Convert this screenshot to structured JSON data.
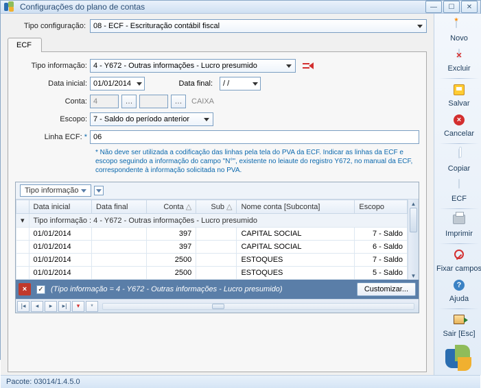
{
  "window": {
    "title": "Configurações do plano de contas"
  },
  "toolbar": {
    "novo": "Novo",
    "excluir": "Excluir",
    "salvar": "Salvar",
    "cancelar": "Cancelar",
    "copiar": "Copiar",
    "ecf": "ECF",
    "imprimir": "Imprimir",
    "fixar": "Fixar campos",
    "ajuda": "Ajuda",
    "sair": "Sair [Esc]"
  },
  "top": {
    "tipo_config_label": "Tipo configuração:",
    "tipo_config_value": "08 - ECF - Escrituração contábil fiscal"
  },
  "tab": {
    "label": "ECF"
  },
  "form": {
    "tipo_info_label": "Tipo informação:",
    "tipo_info_value": "4 - Y672 - Outras informações - Lucro presumido",
    "data_inicial_label": "Data inicial:",
    "data_inicial_value": "01/01/2014",
    "data_final_label": "Data final:",
    "data_final_value": "/ /",
    "conta_label": "Conta:",
    "conta_value": "4",
    "conta_nome": "CAIXA",
    "escopo_label": "Escopo:",
    "escopo_value": "7 - Saldo do período anterior",
    "linha_label": "Linha ECF:",
    "linha_req": "*",
    "linha_value": "06",
    "note": "* Não deve ser utilizada a codificação das linhas pela tela do PVA da ECF. Indicar as linhas da ECF e escopo seguindo a informação do campo \"N°\", existente no leiaute do registro Y672, no manual da ECF, correspondente à informação solicitada no PVA."
  },
  "grid": {
    "group_field": "Tipo informação",
    "columns": {
      "data_inicial": "Data inicial",
      "data_final": "Data final",
      "conta": "Conta",
      "sub": "Sub",
      "nome": "Nome conta [Subconta]",
      "escopo": "Escopo"
    },
    "group_row": "Tipo informação : 4 - Y672 - Outras informações - Lucro presumido",
    "rows": [
      {
        "data_inicial": "01/01/2014",
        "conta": "397",
        "nome": "CAPITAL SOCIAL",
        "escopo": "7 - Saldo"
      },
      {
        "data_inicial": "01/01/2014",
        "conta": "397",
        "nome": "CAPITAL SOCIAL",
        "escopo": "6 - Saldo"
      },
      {
        "data_inicial": "01/01/2014",
        "conta": "2500",
        "nome": "ESTOQUES",
        "escopo": "7 - Saldo"
      },
      {
        "data_inicial": "01/01/2014",
        "conta": "2500",
        "nome": "ESTOQUES",
        "escopo": "5 - Saldo"
      }
    ],
    "filter_text": "(Tipo informação = 4 - Y672 - Outras informações - Lucro presumido)",
    "customize": "Customizar..."
  },
  "footer": {
    "pacote": "Pacote: 03014/1.4.5.0"
  }
}
